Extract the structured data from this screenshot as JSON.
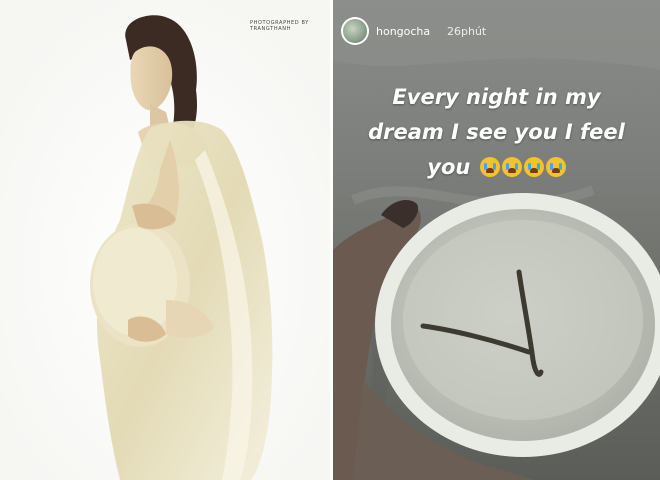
{
  "left_photo": {
    "credit": "PHOTOGRAPHED BY TRANGTHANH"
  },
  "story": {
    "username": "hongocha",
    "time_ago": "26phút",
    "caption_lines": [
      "Every night in my",
      "dream I see you I feel",
      "you"
    ],
    "emojis": [
      "loudly-crying-face-icon",
      "loudly-crying-face-icon",
      "loudly-crying-face-icon",
      "loudly-crying-face-icon"
    ],
    "colors": {
      "caption_text": "#ffffff",
      "emoji_yellow": "#f4c22b"
    }
  }
}
